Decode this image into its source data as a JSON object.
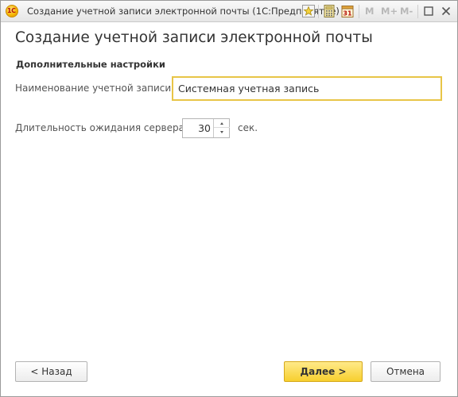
{
  "window": {
    "title": "Создание учетной записи электронной почты  (1С:Предприятие)",
    "logo_text": "1С"
  },
  "toolbar": {
    "m_label": "M",
    "m_plus_label": "M+",
    "m_minus_label": "M-",
    "calendar_day": "31"
  },
  "page": {
    "title": "Создание учетной записи электронной почты",
    "section_title": "Дополнительные настройки"
  },
  "form": {
    "account_name_label": "Наименование учетной записи:",
    "account_name_value": "Системная учетная запись",
    "timeout_label": "Длительность ожидания сервера:",
    "timeout_value": "30",
    "timeout_unit": "сек."
  },
  "buttons": {
    "back": "< Назад",
    "next": "Далее >",
    "cancel": "Отмена"
  },
  "colors": {
    "accent_yellow": "#f7cf2e",
    "field_focus_border": "#e8c547"
  }
}
